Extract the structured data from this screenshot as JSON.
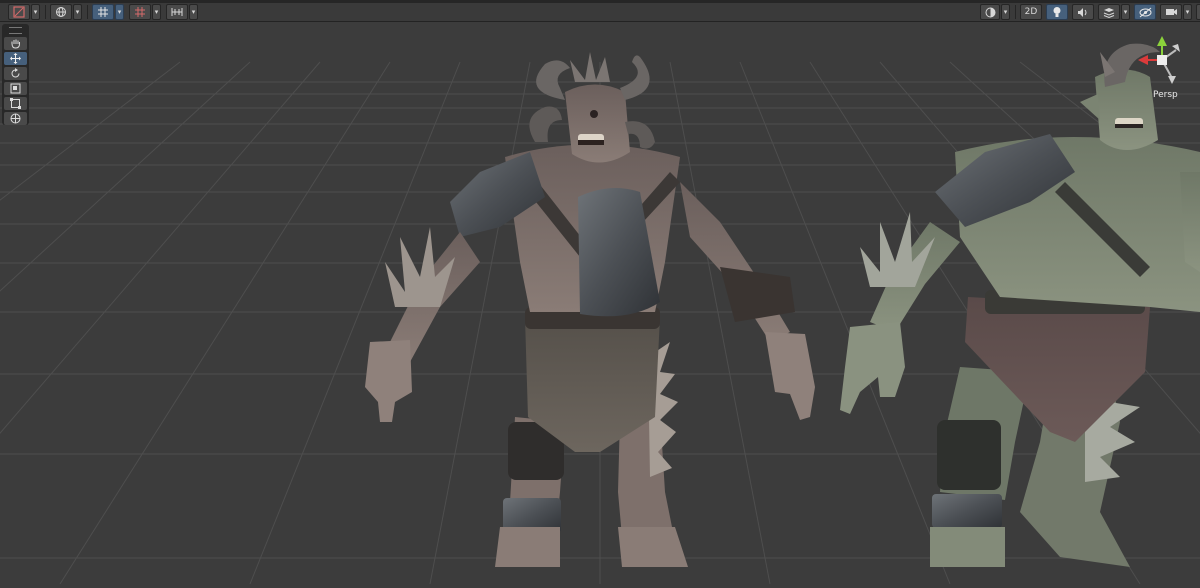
{
  "toolbar": {
    "left": [
      {
        "icon": "transform-tools-icon",
        "dropdown": true,
        "active": false
      },
      {
        "icon": "global-pivot-icon",
        "dropdown": true,
        "active": false
      },
      {
        "icon": "grid-snap-icon",
        "dropdown": true,
        "active": true
      },
      {
        "icon": "increment-snap-icon",
        "dropdown": true,
        "active": false
      },
      {
        "icon": "grid-visibility-icon",
        "dropdown": true,
        "active": false
      }
    ],
    "right": {
      "shading_icon": "shading-mode-icon",
      "mode_2d_label": "2D",
      "lighting_icon": "lighting-icon",
      "audio_icon": "audio-icon",
      "effects_icon": "effects-icon",
      "hidden_icon": "scene-visibility-icon",
      "camera_icon": "scene-camera-icon",
      "gizmos_icon": "gizmos-icon"
    }
  },
  "tools": [
    "hand-tool-icon",
    "move-tool-icon",
    "rotate-tool-icon",
    "scale-tool-icon",
    "rect-tool-icon",
    "transform-tool-icon"
  ],
  "active_tool": "move-tool-icon",
  "gizmo": {
    "projection_label": "Persp",
    "axis_colors": {
      "x": "#db3b3b",
      "y": "#8bd23b",
      "z": "#3b7bdb"
    }
  },
  "colors": {
    "viewport_bg": "#3c3c3c",
    "grid_line": "#4c4c4c",
    "toolbar_active": "#46607c"
  },
  "scene_objects": [
    "horned-ogre-model",
    "green-ogre-model"
  ]
}
